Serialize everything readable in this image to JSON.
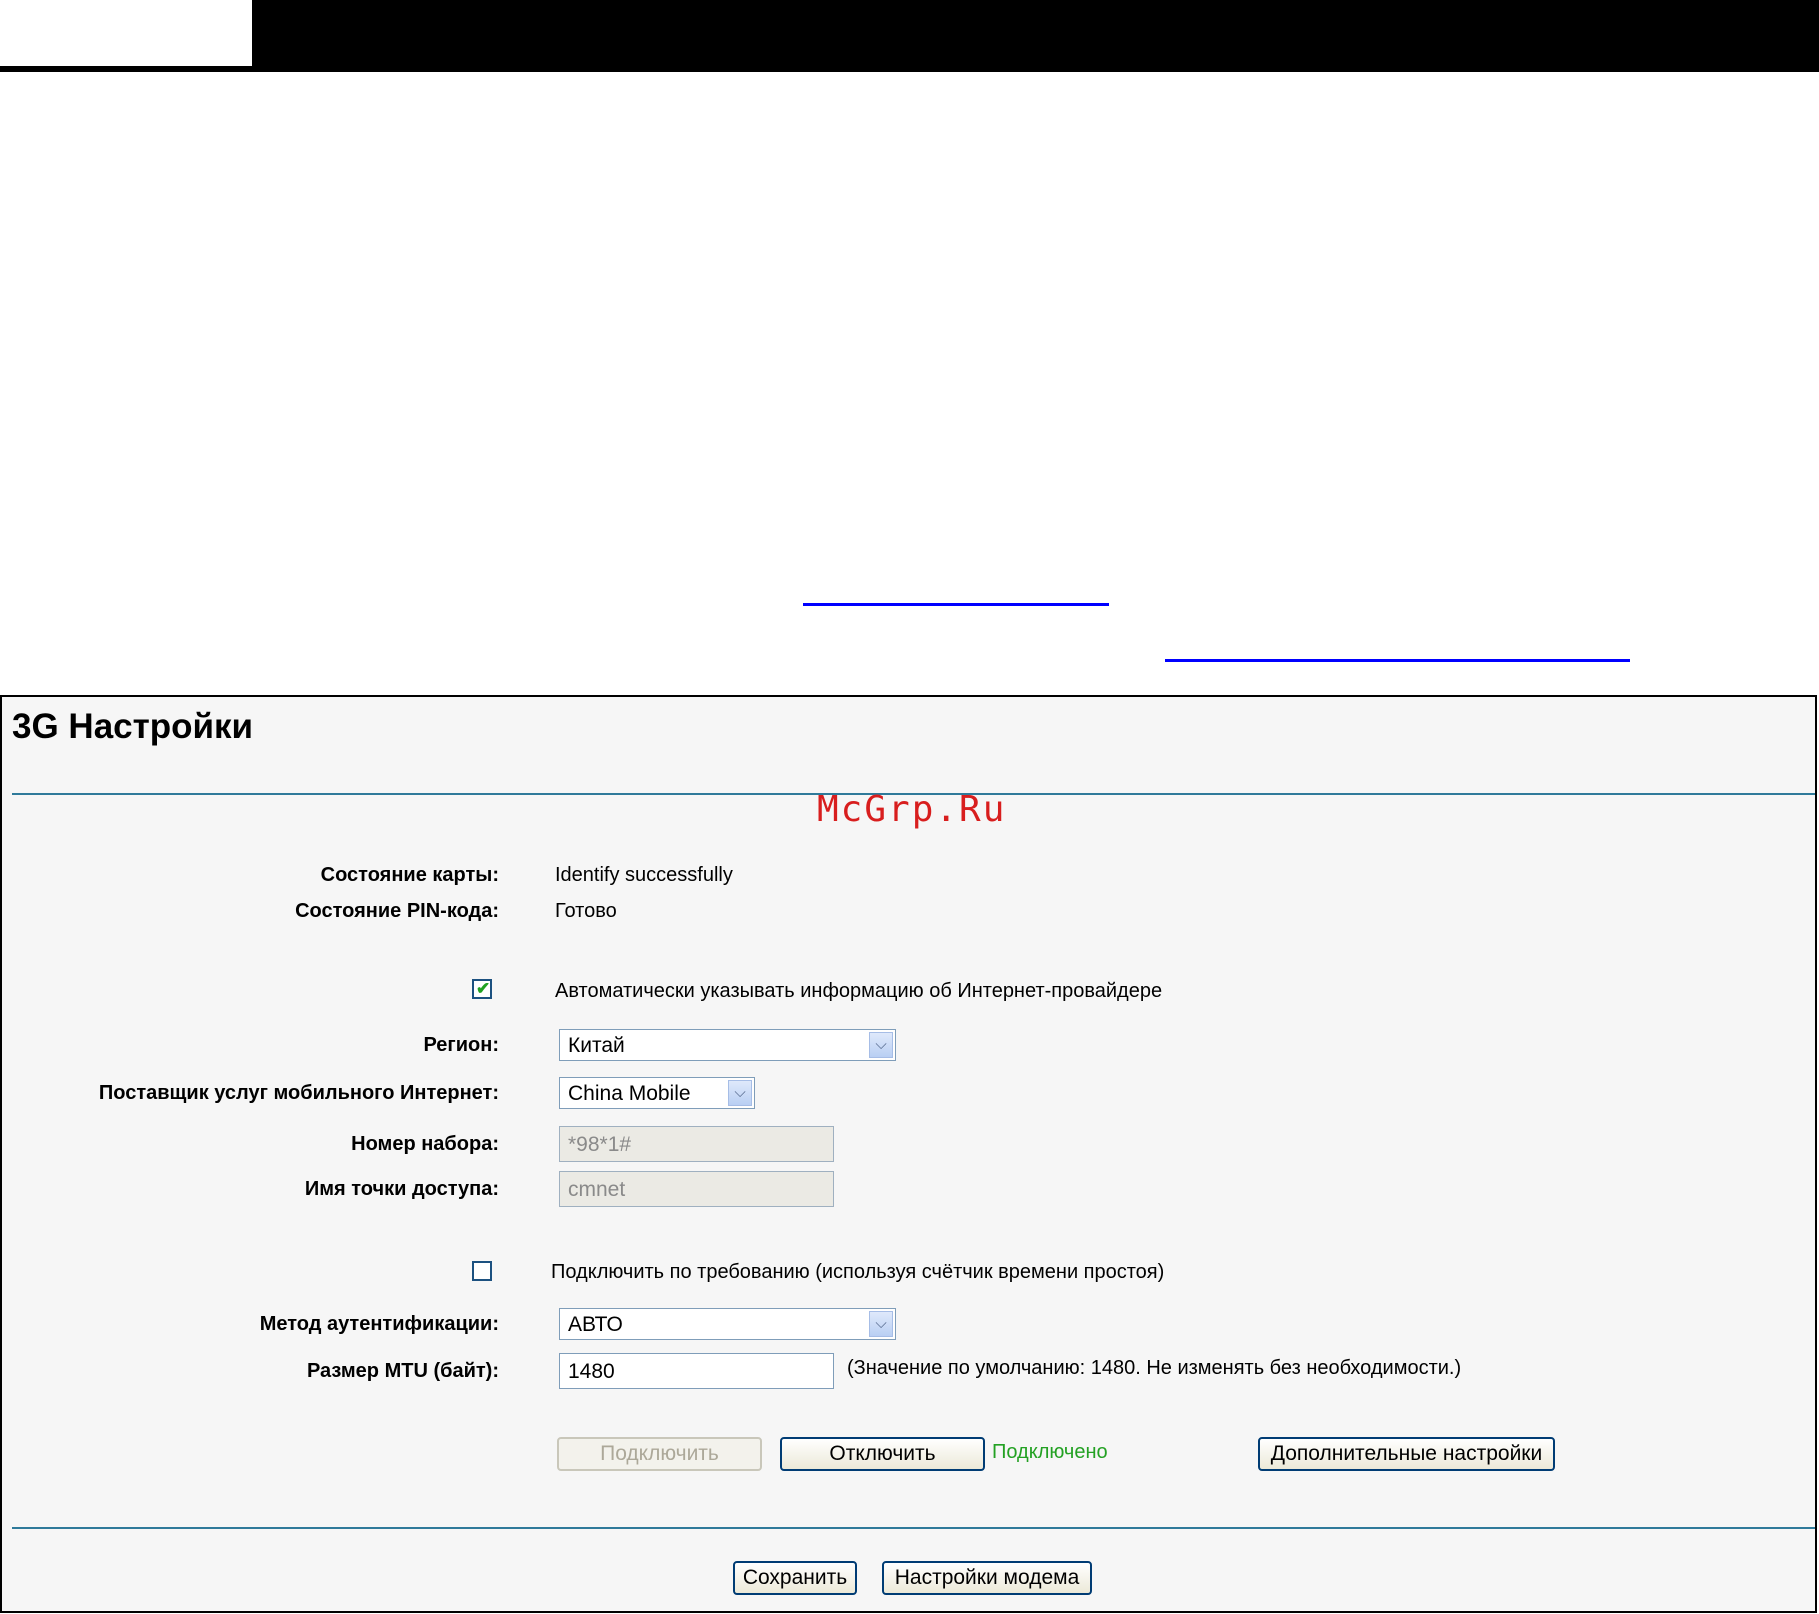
{
  "page": {
    "title": "3G Настройки",
    "watermark": "McGrp.Ru"
  },
  "status": {
    "card_label": "Состояние карты:",
    "card_value": "Identify successfully",
    "pin_label": "Состояние PIN-кода:",
    "pin_value": "Готово"
  },
  "auto_isp": {
    "checked": true,
    "label": "Автоматически указывать информацию об Интернет-провайдере"
  },
  "region": {
    "label": "Регион:",
    "value": "Китай"
  },
  "provider": {
    "label": "Поставщик услуг мобильного Интернет:",
    "value": "China Mobile"
  },
  "dial": {
    "label": "Номер набора:",
    "value": "*98*1#"
  },
  "apn": {
    "label": "Имя точки доступа:",
    "value": "cmnet"
  },
  "on_demand": {
    "checked": false,
    "label": "Подключить по требованию (используя счётчик времени простоя)"
  },
  "auth": {
    "label": "Метод аутентификации:",
    "value": "АВТО"
  },
  "mtu": {
    "label": "Размер MTU (байт):",
    "value": "1480",
    "hint": "(Значение по умолчанию: 1480. Не изменять без необходимости.)"
  },
  "actions": {
    "connect": "Подключить",
    "disconnect": "Отключить",
    "connection_status": "Подключено",
    "advanced": "Дополнительные настройки"
  },
  "footer": {
    "save": "Сохранить",
    "modem": "Настройки модема"
  },
  "colors": {
    "rule": "#2f7a9a",
    "status_ok": "#23a123",
    "watermark": "#d81e1e",
    "link": "#0000ff"
  }
}
